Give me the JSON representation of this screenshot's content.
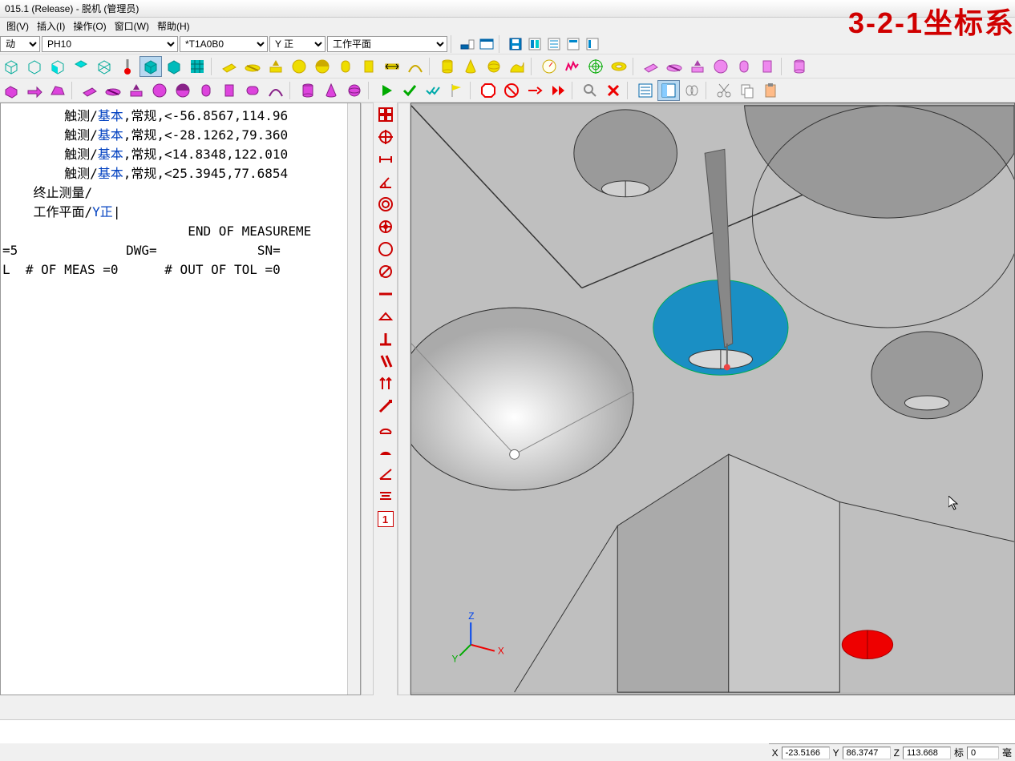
{
  "title": "015.1 (Release) - 脱机 (管理员)",
  "overlay": "3-2-1坐标系",
  "menu": {
    "view": "图(V)",
    "insert": "插入(I)",
    "operate": "操作(O)",
    "window": "窗口(W)",
    "help": "帮助(H)"
  },
  "combos": {
    "c1": "动",
    "c2": "PH10",
    "c3": "*T1A0B0",
    "c4": "Y 正",
    "c5": "工作平面"
  },
  "code": {
    "lines": [
      {
        "pre": "        触测/",
        "kw": "基本",
        "rest": ",常规,<-56.8567,114.96"
      },
      {
        "pre": "        触测/",
        "kw": "基本",
        "rest": ",常规,<-28.1262,79.360"
      },
      {
        "pre": "        触测/",
        "kw": "基本",
        "rest": ",常规,<14.8348,122.010"
      },
      {
        "pre": "        触测/",
        "kw": "基本",
        "rest": ",常规,<25.3945,77.6854"
      },
      {
        "pre": "    终止测量/",
        "kw": "",
        "rest": ""
      },
      {
        "pre": "    工作平面/",
        "kw": "Y正",
        "rest": "|"
      }
    ],
    "end1": "                        END OF MEASUREME",
    "end2": "=5              DWG=             SN=",
    "end3": "L  # OF MEAS =0      # OUT OF TOL =0"
  },
  "feature_page": "1",
  "status": {
    "x_label": "X",
    "x": "-23.5166",
    "y_label": "Y",
    "y": "86.3747",
    "z_label": "Z",
    "z": "113.668",
    "std_label": "标",
    "std": "0",
    "unit": "毫"
  }
}
